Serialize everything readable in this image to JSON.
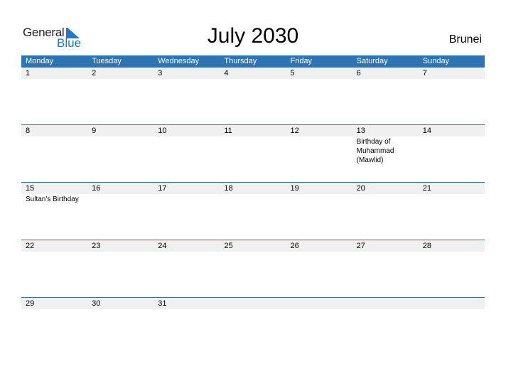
{
  "logo": {
    "word1": "General",
    "word2": "Blue"
  },
  "header": {
    "title": "July 2030",
    "country": "Brunei"
  },
  "colors": {
    "accent": "#2e73b3",
    "day_row_bg": "#f0f0f0"
  },
  "weekdays": [
    "Monday",
    "Tuesday",
    "Wednesday",
    "Thursday",
    "Friday",
    "Saturday",
    "Sunday"
  ],
  "weeks": [
    {
      "days": [
        "1",
        "2",
        "3",
        "4",
        "5",
        "6",
        "7"
      ],
      "events": [
        "",
        "",
        "",
        "",
        "",
        "",
        ""
      ]
    },
    {
      "days": [
        "8",
        "9",
        "10",
        "11",
        "12",
        "13",
        "14"
      ],
      "events": [
        "",
        "",
        "",
        "",
        "",
        "Birthday of Muhammad (Mawlid)",
        ""
      ]
    },
    {
      "days": [
        "15",
        "16",
        "17",
        "18",
        "19",
        "20",
        "21"
      ],
      "events": [
        "Sultan's Birthday",
        "",
        "",
        "",
        "",
        "",
        ""
      ]
    },
    {
      "days": [
        "22",
        "23",
        "24",
        "25",
        "26",
        "27",
        "28"
      ],
      "events": [
        "",
        "",
        "",
        "",
        "",
        "",
        ""
      ]
    },
    {
      "days": [
        "29",
        "30",
        "31",
        "",
        "",
        "",
        ""
      ],
      "events": [
        "",
        "",
        "",
        "",
        "",
        "",
        ""
      ]
    }
  ]
}
